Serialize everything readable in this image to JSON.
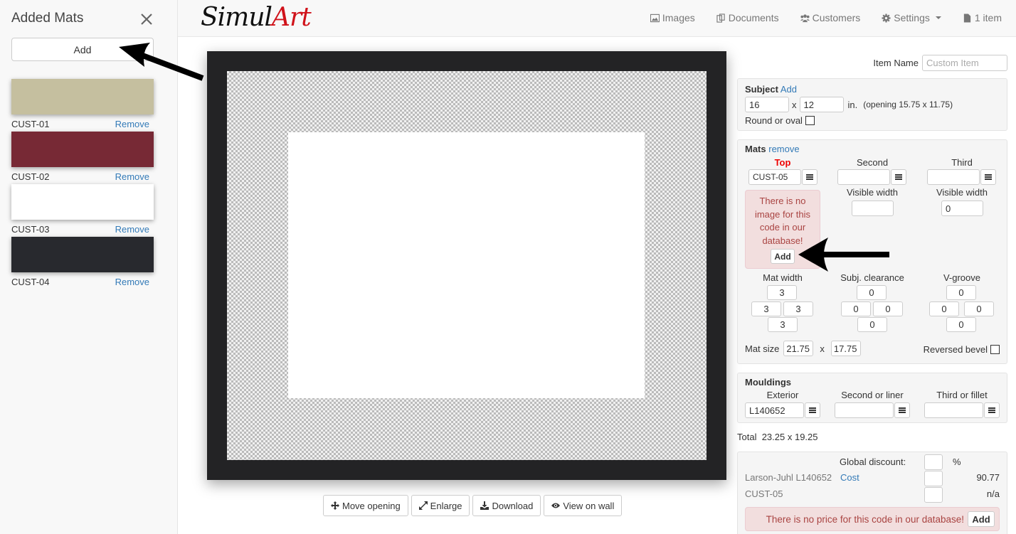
{
  "sidebar": {
    "title": "Added Mats",
    "add_label": "Add",
    "mats": [
      {
        "code": "CUST-01",
        "color": "#c5bf9f",
        "remove_label": "Remove"
      },
      {
        "code": "CUST-02",
        "color": "#772935",
        "remove_label": "Remove"
      },
      {
        "code": "CUST-03",
        "color": "#ffffff",
        "remove_label": "Remove"
      },
      {
        "code": "CUST-04",
        "color": "#28292e",
        "remove_label": "Remove"
      }
    ]
  },
  "header": {
    "logo_part1": "Simul",
    "logo_part2": "Art",
    "nav": [
      {
        "label": "Images",
        "icon": "image-icon"
      },
      {
        "label": "Documents",
        "icon": "documents-icon"
      },
      {
        "label": "Customers",
        "icon": "users-icon"
      },
      {
        "label": "Settings",
        "icon": "gear-icon"
      },
      {
        "label": "1 item",
        "icon": "file-icon"
      }
    ]
  },
  "preview": {
    "buttons": [
      {
        "label": "Move opening",
        "icon": "move-icon"
      },
      {
        "label": "Enlarge",
        "icon": "expand-icon"
      },
      {
        "label": "Download",
        "icon": "download-icon"
      },
      {
        "label": "View on wall",
        "icon": "eye-icon"
      }
    ]
  },
  "item": {
    "name_label": "Item Name",
    "name_placeholder": "Custom Item",
    "name_value": ""
  },
  "subject": {
    "title": "Subject",
    "add_link": "Add",
    "width": "16",
    "height": "12",
    "x_sep": "x",
    "unit": "in.",
    "opening_text": "(opening 15.75 x 11.75)",
    "round_label": "Round or oval",
    "round_checked": false
  },
  "mats": {
    "title": "Mats",
    "remove_link": "remove",
    "top_label": "Top",
    "second_label": "Second",
    "third_label": "Third",
    "top_code": "CUST-05",
    "second_code": "",
    "third_code": "",
    "visible_width_label": "Visible width",
    "second_visible_width": "",
    "third_visible_width": "0",
    "no_image_alert": "There is no image for this code in our database!",
    "alert_add": "Add",
    "mat_width_label": "Mat width",
    "clearance_label": "Subj. clearance",
    "vgroove_label": "V-groove",
    "mat_width": {
      "top": "3",
      "left": "3",
      "right": "3",
      "bottom": "3"
    },
    "clearance": {
      "top": "0",
      "left": "0",
      "right": "0",
      "bottom": "0"
    },
    "vgroove": {
      "top": "0",
      "left": "0",
      "right": "0",
      "bottom": "0"
    },
    "mat_size_label": "Mat size",
    "mat_size_w": "21.75",
    "mat_size_h": "17.75",
    "x_sep": "x",
    "reversed_bevel_label": "Reversed bevel",
    "reversed_bevel_checked": false
  },
  "mouldings": {
    "title": "Mouldings",
    "exterior_label": "Exterior",
    "second_label": "Second or liner",
    "third_label": "Third or fillet",
    "exterior_code": "L140652",
    "second_code": "",
    "third_code": ""
  },
  "total": {
    "label": "Total",
    "value": "23.25 x 19.25"
  },
  "pricing": {
    "global_discount_label": "Global discount:",
    "percent_sign": "%",
    "rows": [
      {
        "name": "Larson-Juhl L140652",
        "link": "Cost",
        "value": "90.77"
      },
      {
        "name": "CUST-05",
        "link": "",
        "value": "n/a"
      }
    ],
    "no_price_alert": "There is no price for this code in our database!",
    "alert_add": "Add"
  }
}
